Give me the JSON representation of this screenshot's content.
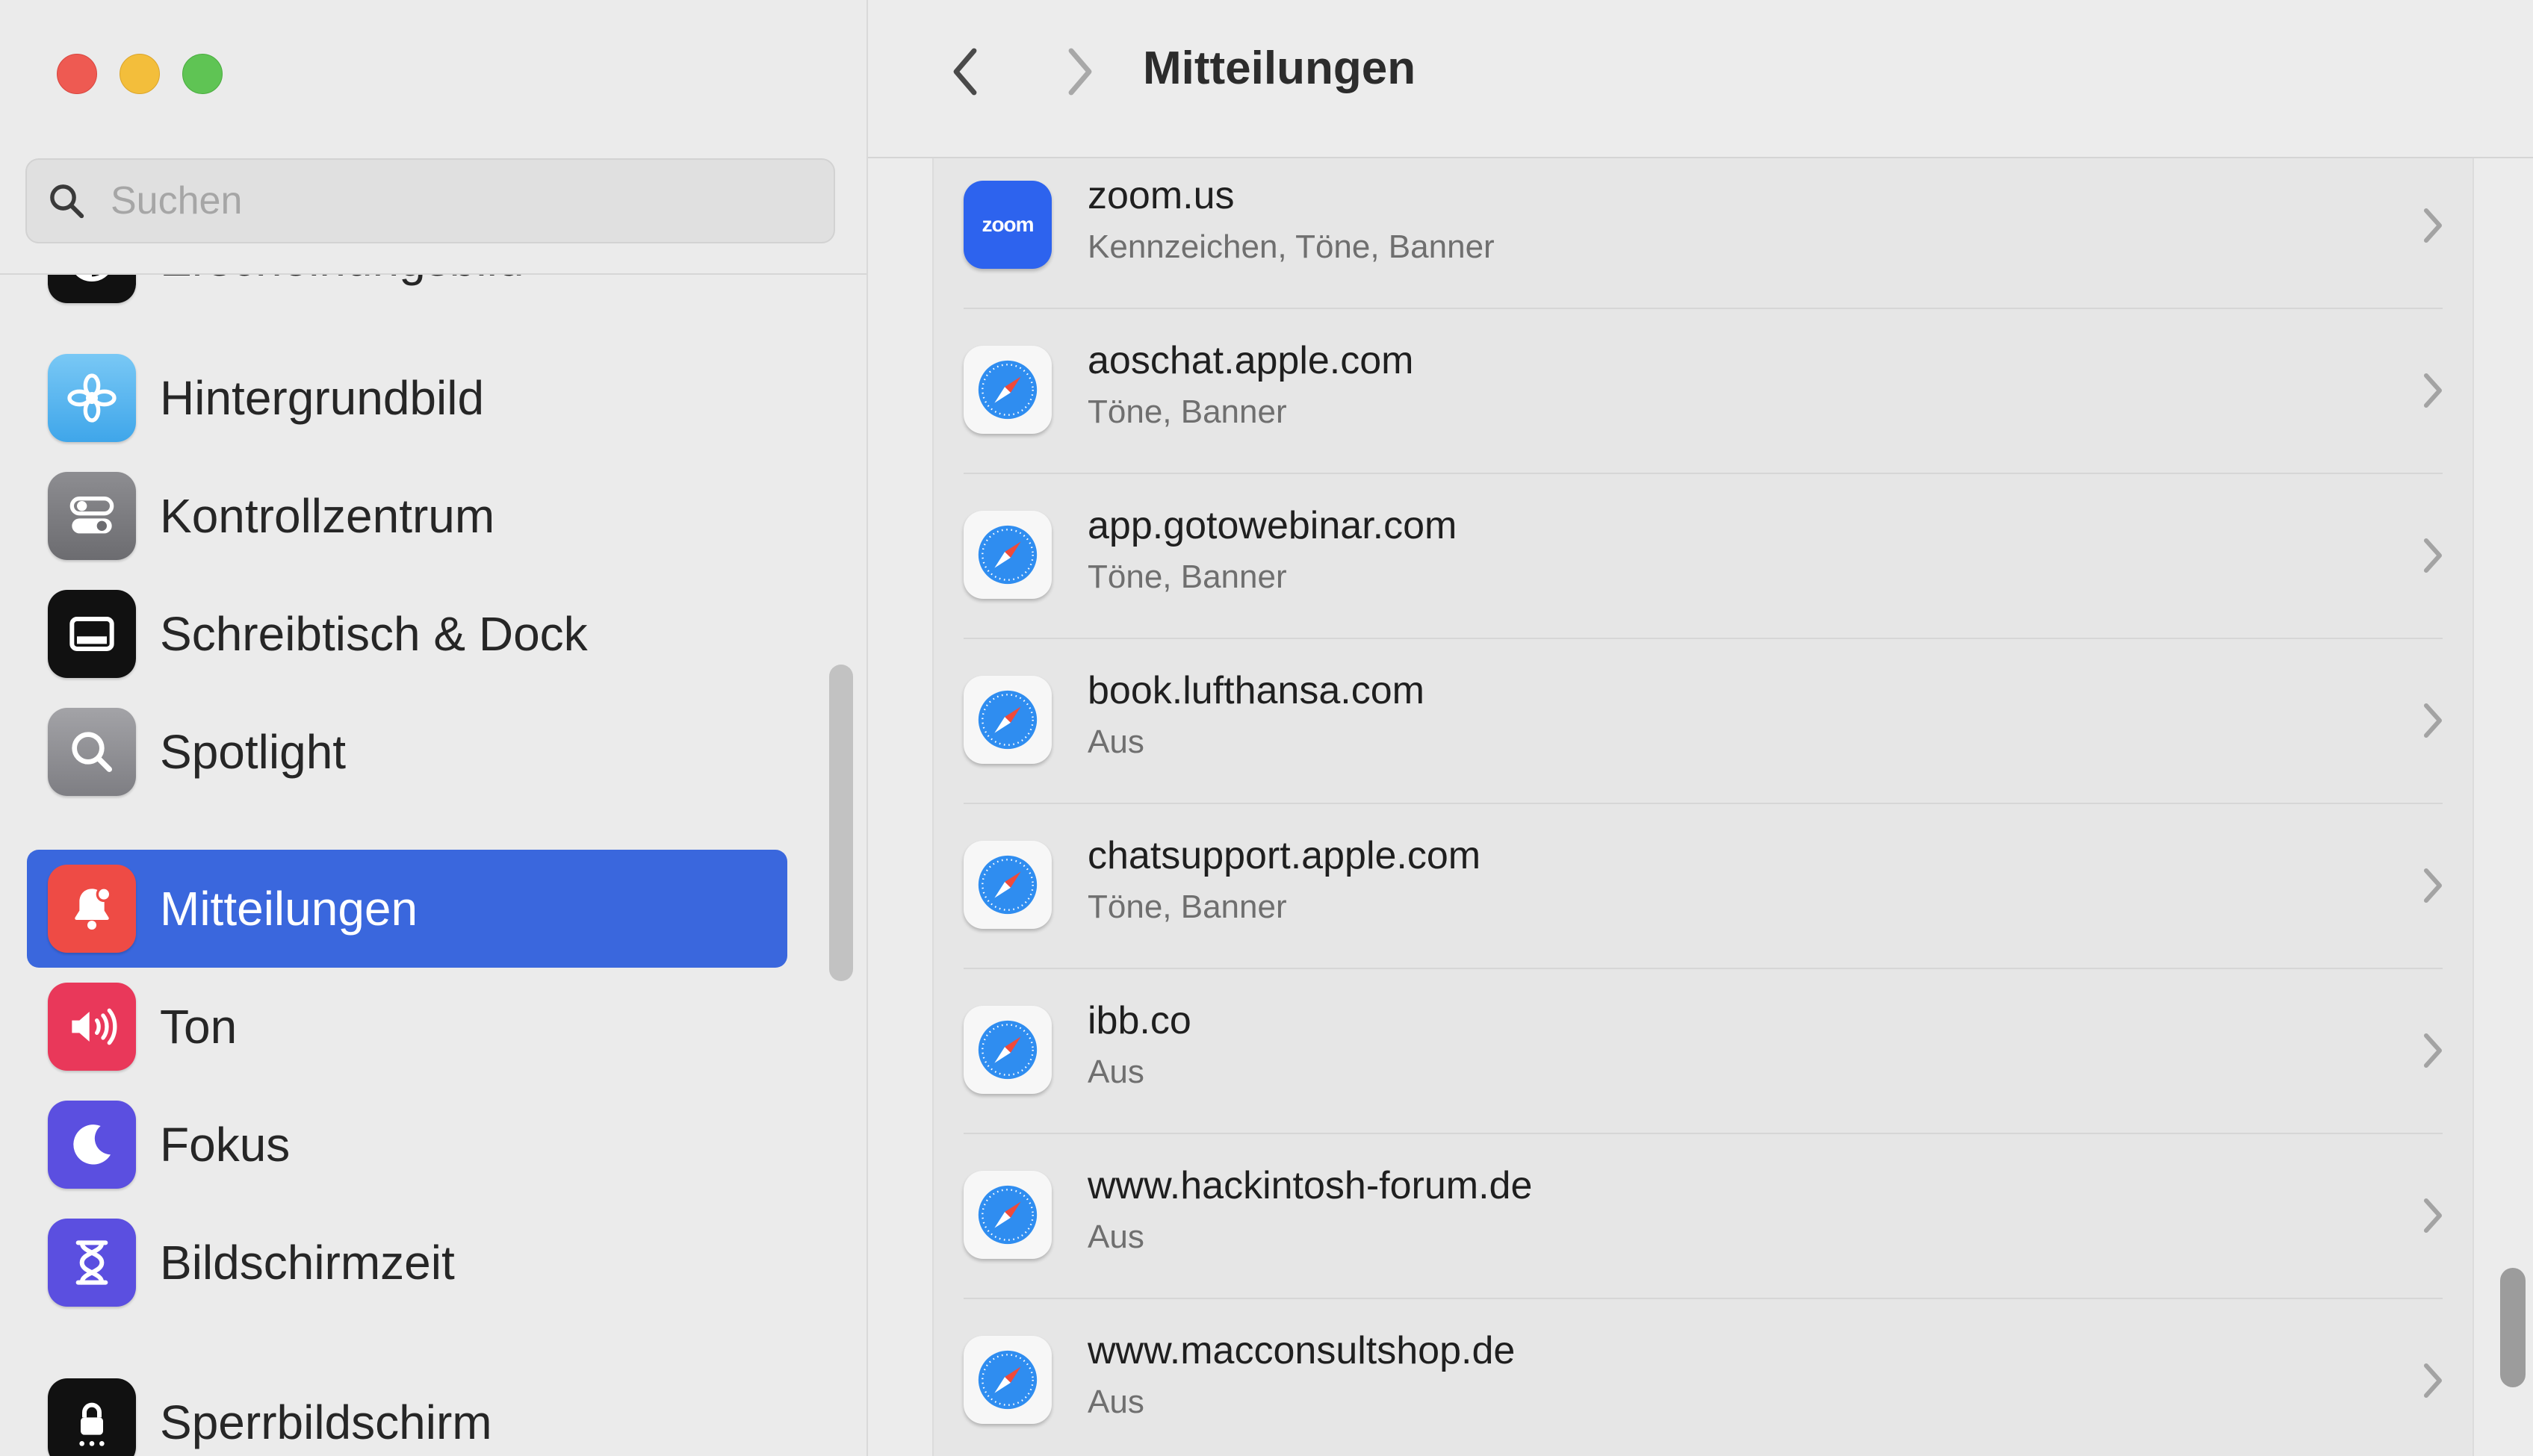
{
  "sidebar": {
    "search": {
      "placeholder": "Suchen",
      "value": ""
    },
    "items": [
      {
        "label": "Erscheinungsbild",
        "icon": "appearance-icon"
      },
      {
        "label": "Hintergrundbild",
        "icon": "wallpaper-icon"
      },
      {
        "label": "Kontrollzentrum",
        "icon": "control-center-icon"
      },
      {
        "label": "Schreibtisch & Dock",
        "icon": "desktop-dock-icon"
      },
      {
        "label": "Spotlight",
        "icon": "spotlight-icon"
      },
      {
        "label": "Mitteilungen",
        "icon": "notifications-icon",
        "selected": true
      },
      {
        "label": "Ton",
        "icon": "sound-icon"
      },
      {
        "label": "Fokus",
        "icon": "focus-icon"
      },
      {
        "label": "Bildschirmzeit",
        "icon": "screen-time-icon"
      },
      {
        "label": "Sperrbildschirm",
        "icon": "lock-screen-icon"
      }
    ]
  },
  "header": {
    "title": "Mitteilungen"
  },
  "apps": [
    {
      "name": "zoom.us",
      "detail": "Kennzeichen, Töne, Banner",
      "icon": "zoom-icon",
      "icon_text": "zoom"
    },
    {
      "name": "aoschat.apple.com",
      "detail": "Töne, Banner",
      "icon": "safari-icon"
    },
    {
      "name": "app.gotowebinar.com",
      "detail": "Töne, Banner",
      "icon": "safari-icon"
    },
    {
      "name": "book.lufthansa.com",
      "detail": "Aus",
      "icon": "safari-icon"
    },
    {
      "name": "chatsupport.apple.com",
      "detail": "Töne, Banner",
      "icon": "safari-icon"
    },
    {
      "name": "ibb.co",
      "detail": "Aus",
      "icon": "safari-icon"
    },
    {
      "name": "www.hackintosh-forum.de",
      "detail": "Aus",
      "icon": "safari-icon"
    },
    {
      "name": "www.macconsultshop.de",
      "detail": "Aus",
      "icon": "safari-icon"
    }
  ],
  "colors": {
    "accent": "#3a67dd",
    "notifications_icon": "#ee4b45",
    "sound_icon": "#e9385a",
    "focus_icon": "#5b4fe0",
    "screen_time_icon": "#5b4fe0",
    "zoom_icon": "#2d63ee"
  }
}
